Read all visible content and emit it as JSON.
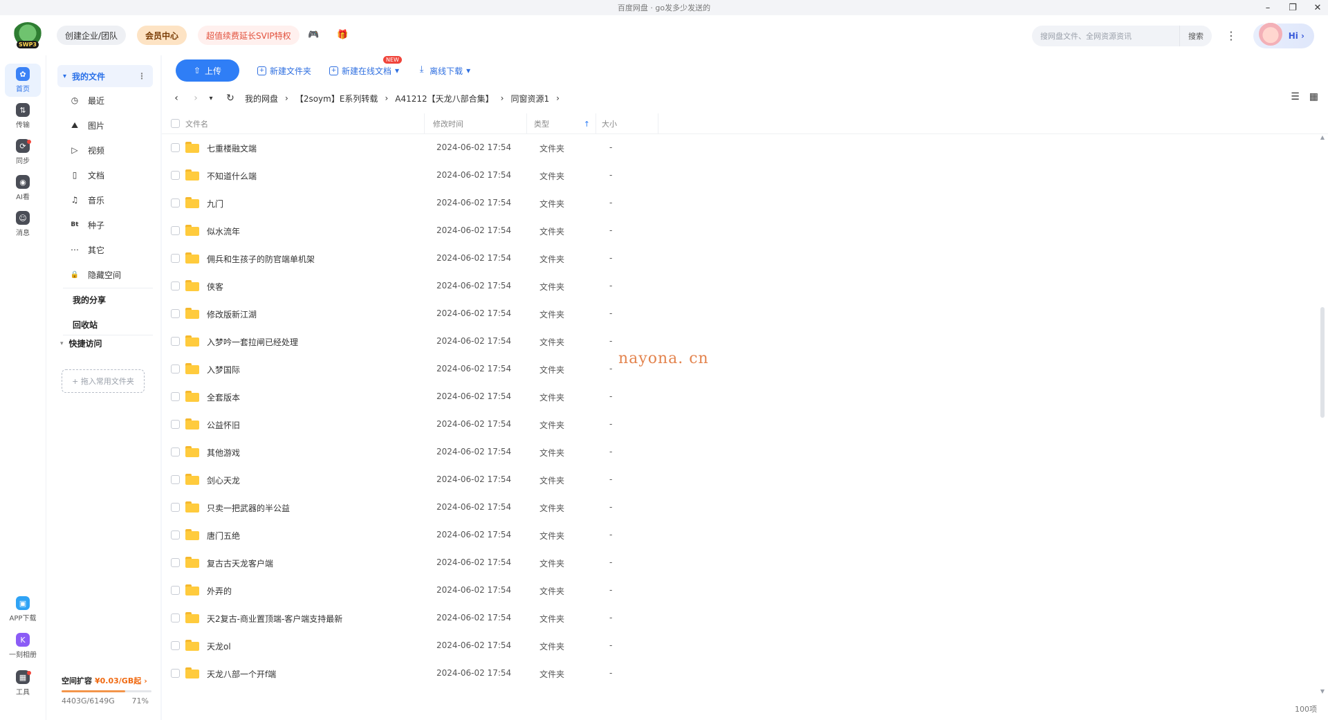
{
  "window": {
    "title": "百度网盘 · go发多少发送的",
    "controls": {
      "minimize": "–",
      "restore": "❐",
      "close": "✕"
    }
  },
  "header": {
    "logo_text": "SWP3",
    "team_label": "创建企业/团队",
    "vip_label": "会员中心",
    "svip_label": "超值续费延长SVIP特权",
    "game_icon": "🎮",
    "gift_icon": "🎁",
    "search_placeholder": "搜网盘文件、全网资源资讯",
    "search_button": "搜索",
    "greeting": "Hi",
    "more_icon": "⋮"
  },
  "rail": {
    "items": [
      {
        "label": "首页",
        "glyph": "✿",
        "active": true
      },
      {
        "label": "传输",
        "glyph": "⇅"
      },
      {
        "label": "同步",
        "glyph": "⟳",
        "badge": true
      },
      {
        "label": "AI看",
        "glyph": "◉"
      },
      {
        "label": "消息",
        "glyph": "☺"
      }
    ],
    "bottom": [
      {
        "label": "APP下载",
        "glyph": "▣"
      },
      {
        "label": "一刻相册",
        "glyph": "K"
      },
      {
        "label": "工具",
        "glyph": "▦",
        "badge": true
      }
    ]
  },
  "sidebar": {
    "my_files": "我的文件",
    "kebab": "⋮",
    "caret": "▾",
    "items": [
      {
        "label": "最近",
        "icon": "◷"
      },
      {
        "label": "图片",
        "icon": "⛰"
      },
      {
        "label": "视频",
        "icon": "▷"
      },
      {
        "label": "文档",
        "icon": "▯"
      },
      {
        "label": "音乐",
        "icon": "♫"
      },
      {
        "label": "种子",
        "icon": "Bt"
      },
      {
        "label": "其它",
        "icon": "⋯"
      },
      {
        "label": "隐藏空间",
        "icon": "🔒"
      }
    ],
    "my_share": "我的分享",
    "recycle": "回收站",
    "quick_access": "快捷访问",
    "drop_hint": "+ 拖入常用文件夹",
    "quota": {
      "title": "空间扩容",
      "price": "¥0.03/GB起",
      "arrow": "›",
      "used_text": "4403G/6149G",
      "percent_text": "71%",
      "used_fraction": 0.71
    }
  },
  "toolbar": {
    "upload": "上传",
    "upload_icon": "⇧",
    "new_folder": "新建文件夹",
    "new_doc": "新建在线文档",
    "new_badge": "NEW",
    "offline": "离线下载",
    "dropdown_icon": "▾"
  },
  "breadcrumb": {
    "back": "‹",
    "forward": "›",
    "history": "▾",
    "refresh": "↻",
    "sep": "›",
    "path": [
      "我的网盘",
      "【2soym】E系列转载",
      "A41212【天龙八部合集】",
      "同窗资源1"
    ]
  },
  "view_icons": {
    "sort": "☰",
    "grid": "▦"
  },
  "table": {
    "headers": {
      "name": "文件名",
      "time": "修改时间",
      "type": "类型",
      "size": "大小"
    },
    "sort_icon": "↑",
    "rows": [
      {
        "name": "七重楼融文端",
        "time": "2024-06-02 17:54",
        "type": "文件夹",
        "size": "-"
      },
      {
        "name": "不知道什么端",
        "time": "2024-06-02 17:54",
        "type": "文件夹",
        "size": "-"
      },
      {
        "name": "九门",
        "time": "2024-06-02 17:54",
        "type": "文件夹",
        "size": "-"
      },
      {
        "name": "似水流年",
        "time": "2024-06-02 17:54",
        "type": "文件夹",
        "size": "-"
      },
      {
        "name": "佣兵和生孩子的防官端单机架",
        "time": "2024-06-02 17:54",
        "type": "文件夹",
        "size": "-"
      },
      {
        "name": "侠客",
        "time": "2024-06-02 17:54",
        "type": "文件夹",
        "size": "-"
      },
      {
        "name": "修改版新江湖",
        "time": "2024-06-02 17:54",
        "type": "文件夹",
        "size": "-"
      },
      {
        "name": "入梦吟一套拉闸已经处理",
        "time": "2024-06-02 17:54",
        "type": "文件夹",
        "size": "-"
      },
      {
        "name": "入梦国际",
        "time": "2024-06-02 17:54",
        "type": "文件夹",
        "size": "-"
      },
      {
        "name": "全套版本",
        "time": "2024-06-02 17:54",
        "type": "文件夹",
        "size": "-"
      },
      {
        "name": "公益怀旧",
        "time": "2024-06-02 17:54",
        "type": "文件夹",
        "size": "-"
      },
      {
        "name": "其他游戏",
        "time": "2024-06-02 17:54",
        "type": "文件夹",
        "size": "-"
      },
      {
        "name": "剑心天龙",
        "time": "2024-06-02 17:54",
        "type": "文件夹",
        "size": "-"
      },
      {
        "name": "只卖一把武器的半公益",
        "time": "2024-06-02 17:54",
        "type": "文件夹",
        "size": "-"
      },
      {
        "name": "唐门五绝",
        "time": "2024-06-02 17:54",
        "type": "文件夹",
        "size": "-"
      },
      {
        "name": "复古古天龙客户端",
        "time": "2024-06-02 17:54",
        "type": "文件夹",
        "size": "-"
      },
      {
        "name": "外弄的",
        "time": "2024-06-02 17:54",
        "type": "文件夹",
        "size": "-"
      },
      {
        "name": "天2复古-商业置顶端-客户端支持最新",
        "time": "2024-06-02 17:54",
        "type": "文件夹",
        "size": "-"
      },
      {
        "name": "天龙ol",
        "time": "2024-06-02 17:54",
        "type": "文件夹",
        "size": "-"
      },
      {
        "name": "天龙八部一个开f端",
        "time": "2024-06-02 17:54",
        "type": "文件夹",
        "size": "-"
      }
    ]
  },
  "scroll": {
    "up": "▲",
    "down": "▼"
  },
  "footer": {
    "count": "100项"
  },
  "watermark": "nayona. cn"
}
